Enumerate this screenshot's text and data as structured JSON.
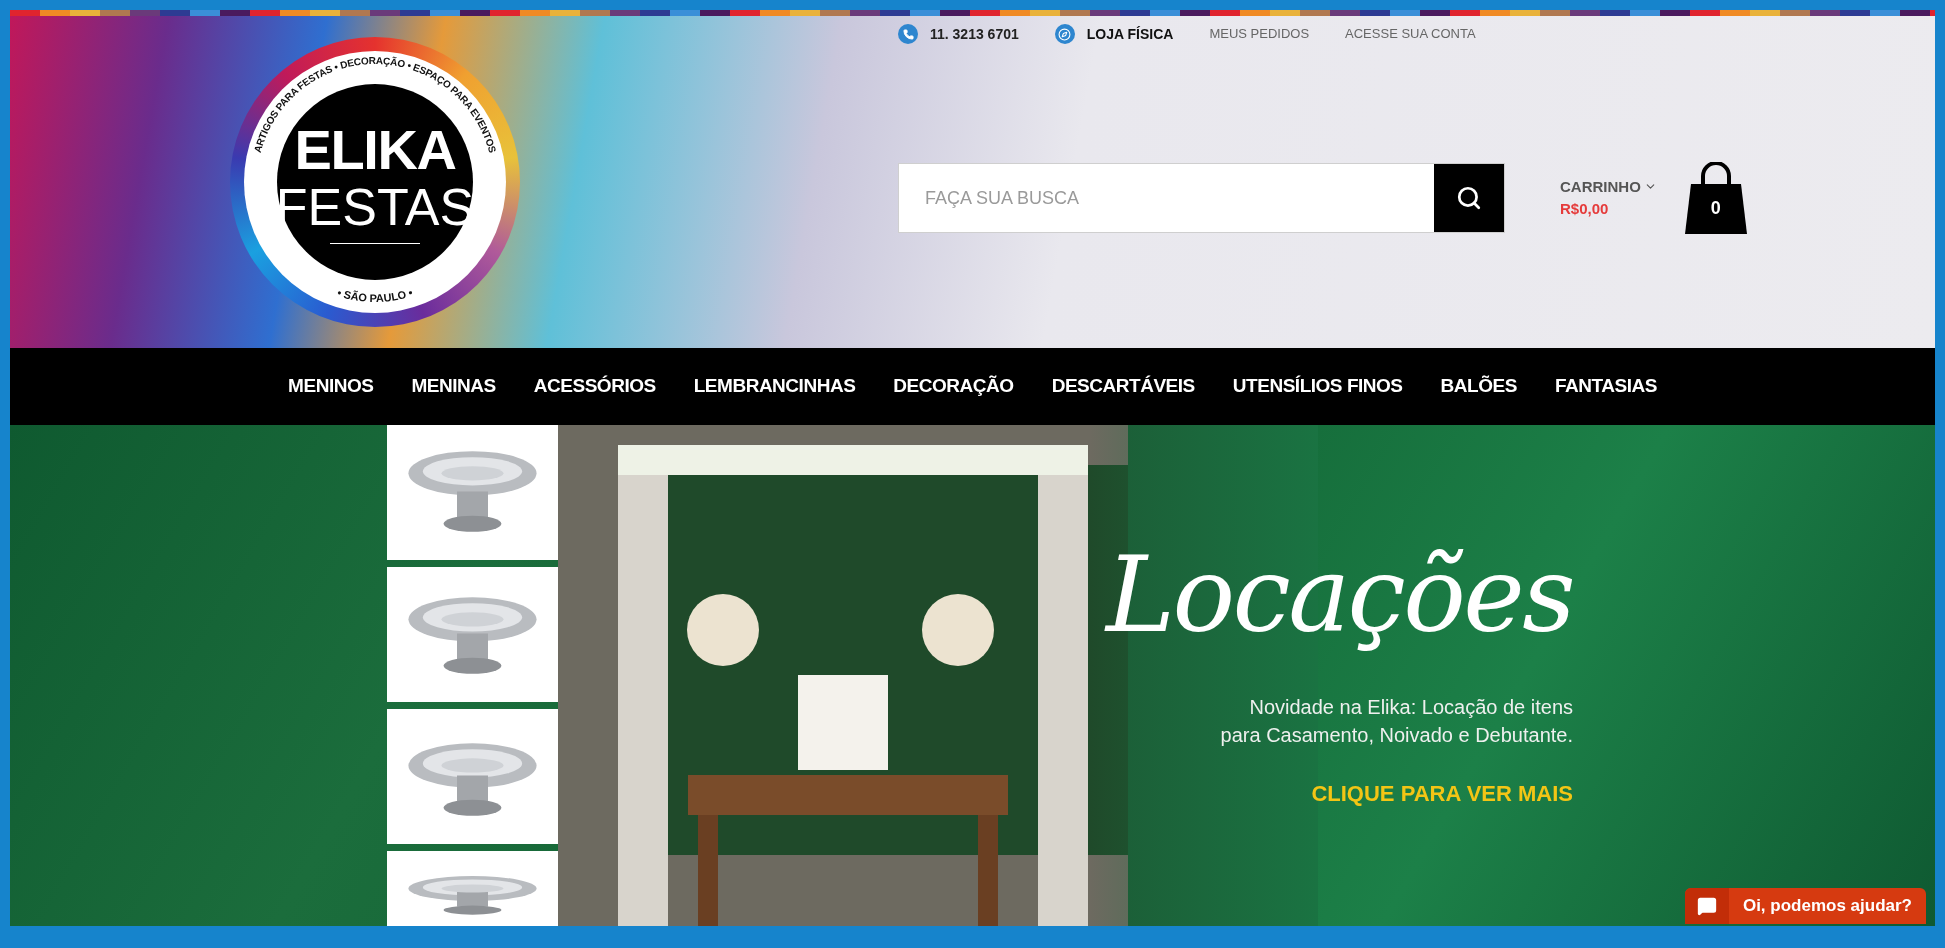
{
  "top_bar": {
    "phone": "11. 3213 6701",
    "store_link": "LOJA FÍSICA",
    "links": [
      "MEUS PEDIDOS",
      "ACESSE SUA CONTA"
    ]
  },
  "logo": {
    "line1": "ELIKA",
    "line2": "FESTAS",
    "ring_top": "ARTIGOS PARA FESTAS • DECORAÇÃO • ESPAÇO PARA EVENTOS",
    "ring_bottom": "• SÃO PAULO •"
  },
  "search": {
    "placeholder": "FAÇA SUA BUSCA"
  },
  "cart": {
    "label": "CARRINHO",
    "total": "R$0,00",
    "count": "0"
  },
  "nav": [
    "MENINOS",
    "MENINAS",
    "ACESSÓRIOS",
    "LEMBRANCINHAS",
    "DECORAÇÃO",
    "DESCARTÁVEIS",
    "UTENSÍLIOS FINOS",
    "BALÕES",
    "FANTASIAS"
  ],
  "banner": {
    "title": "Locações",
    "text": "Novidade na Elika: Locação de itens\npara Casamento, Noivado e Debutante.",
    "cta": "CLIQUE PARA VER MAIS"
  },
  "chat": {
    "label": "Oi, podemos ajudar?"
  }
}
